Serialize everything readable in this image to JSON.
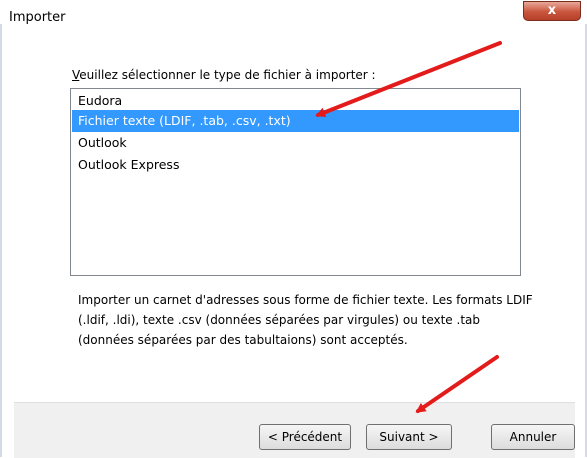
{
  "window": {
    "title": "Importer",
    "close_glyph": "x"
  },
  "prompt": "Veuillez sélectionner le type de fichier à importer :",
  "file_types": [
    {
      "label": "Eudora",
      "selected": false
    },
    {
      "label": "Fichier texte (LDIF, .tab, .csv, .txt)",
      "selected": true
    },
    {
      "label": "Outlook",
      "selected": false
    },
    {
      "label": "Outlook Express",
      "selected": false
    }
  ],
  "description": "Importer un carnet d'adresses sous forme de fichier texte. Les formats LDIF (.ldif, .ldi), texte .csv (données séparées par virgules) ou texte .tab (données séparées par des tabultaions) sont acceptés.",
  "buttons": {
    "back": "< Précédent",
    "next": "Suivant >",
    "cancel": "Annuler"
  },
  "colors": {
    "selection": "#3399ff",
    "annotation_arrow": "#e31b1b"
  }
}
